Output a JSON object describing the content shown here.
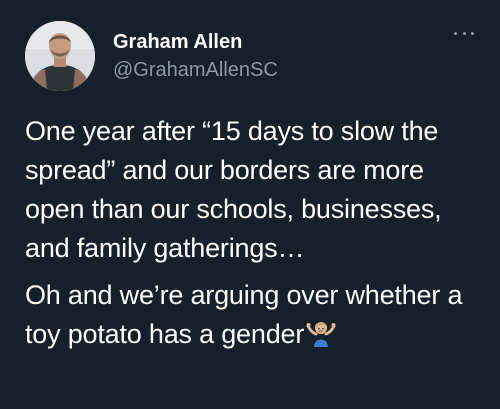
{
  "tweet": {
    "author": {
      "name": "Graham Allen",
      "handle": "@GrahamAllenSC",
      "avatar_icon": "profile-photo"
    },
    "menu_icon": "more-horizontal-icon",
    "paragraphs": [
      "One year after “15 days to slow the spread” and our borders are more open than our schools, businesses, and family gatherings…",
      "Oh and we’re arguing over whether a toy potato has a gender"
    ],
    "emoji": {
      "name": "person-shrugging-emoji",
      "char": "🤷"
    }
  },
  "colors": {
    "background": "#15202b",
    "primary_text": "#ffffff",
    "secondary_text": "#8b98a5"
  }
}
